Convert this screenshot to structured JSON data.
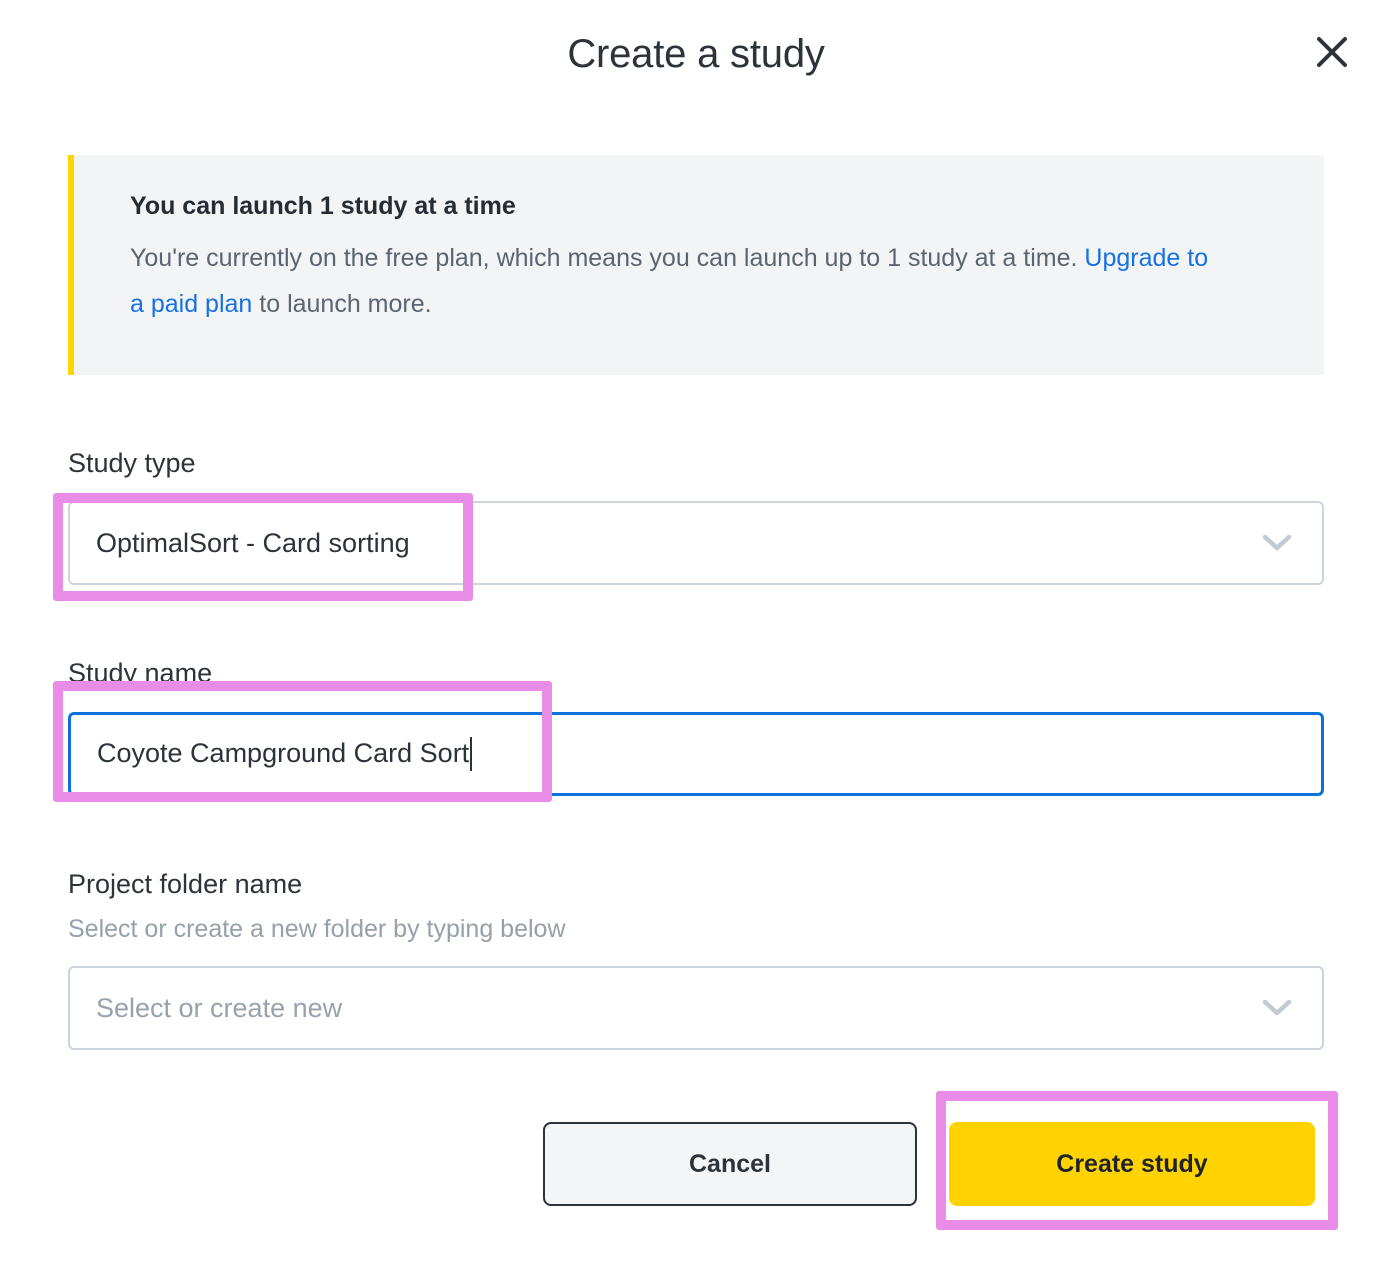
{
  "modal": {
    "title": "Create a study",
    "close_icon": "close-icon"
  },
  "banner": {
    "title": "You can launch 1 study at a time",
    "body_before": "You're currently on the free plan, which means you can launch up to 1 study at a time. ",
    "link_text": "Upgrade to a paid plan",
    "body_after": " to launch more.",
    "accent_color": "#ffd500",
    "background_color": "#f2f4f6",
    "link_color": "#1871e0"
  },
  "fields": {
    "study_type": {
      "label": "Study type",
      "value": "OptimalSort - Card sorting",
      "icon": "chevron-down-icon"
    },
    "study_name": {
      "label": "Study name",
      "value": "Coyote Campground Card Sort",
      "focused": true
    },
    "project_folder": {
      "label": "Project folder name",
      "help": "Select or create a new folder by typing below",
      "placeholder": "Select or create new",
      "value": "",
      "icon": "chevron-down-icon"
    }
  },
  "footer": {
    "cancel_label": "Cancel",
    "create_label": "Create study",
    "primary_color": "#ffd200"
  },
  "annotations": {
    "highlight_color": "#e98ce8",
    "targets": [
      "study-type-select",
      "study-name-input",
      "create-study-button"
    ]
  }
}
